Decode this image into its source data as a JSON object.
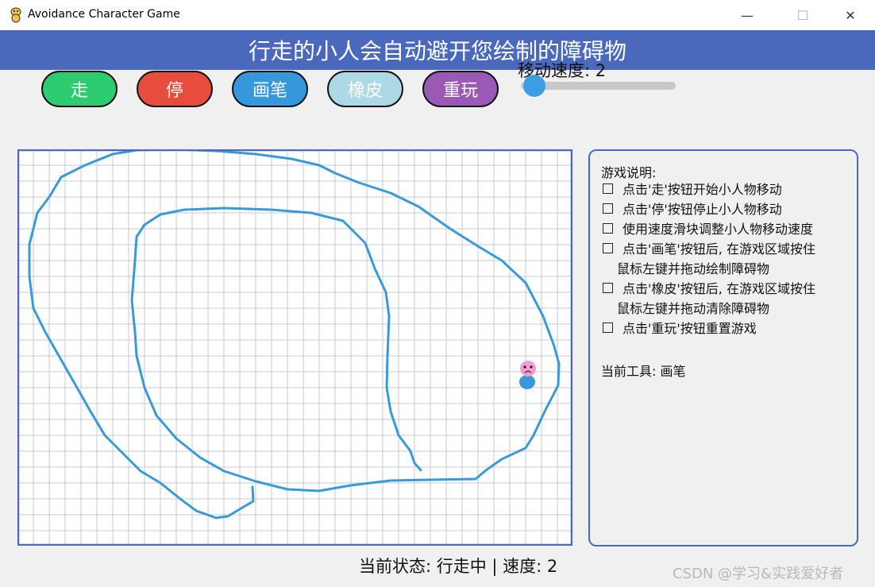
{
  "window": {
    "title": "Avoidance Character Game",
    "minimize_symbol": "—",
    "maximize_symbol": "☐",
    "close_symbol": "✕"
  },
  "header": {
    "title": "行走的小人会自动避开您绘制的障碍物",
    "color": "#4a69bd"
  },
  "toolbar": {
    "buttons": [
      {
        "label": "走",
        "color": "#2ecc71"
      },
      {
        "label": "停",
        "color": "#e74c3c"
      },
      {
        "label": "画笔",
        "color": "#3498db"
      },
      {
        "label": "橡皮",
        "color": "#add8e6"
      },
      {
        "label": "重玩",
        "color": "#9b59b6"
      }
    ],
    "speed_label": "移动速度: 2",
    "speed_value": 2
  },
  "info": {
    "title": "游戏说明:",
    "items": [
      {
        "line1": "点击'走'按钮开始小人物移动",
        "line2": ""
      },
      {
        "line1": "点击'停'按钮停止小人物移动",
        "line2": ""
      },
      {
        "line1": "使用速度滑块调整小人物移动速度",
        "line2": ""
      },
      {
        "line1": "点击'画笔'按钮后, 在游戏区域按住",
        "line2": "鼠标左键并拖动绘制障碍物"
      },
      {
        "line1": "点击'橡皮'按钮后, 在游戏区域按住",
        "line2": "鼠标左键并拖动清除障碍物"
      },
      {
        "line1": "点击'重玩'按钮重置游戏",
        "line2": ""
      }
    ],
    "current_tool": "当前工具: 画笔"
  },
  "status": "当前状态: 行走中 | 速度: 2",
  "watermark": "CSDN @学习&实践爱好者",
  "colors": {
    "obstacle": "#3a9ad9",
    "grid": "#c6c9d4",
    "border": "#4a69bd",
    "character_head": "#f59bd0",
    "character_body": "#3a9ad9"
  }
}
